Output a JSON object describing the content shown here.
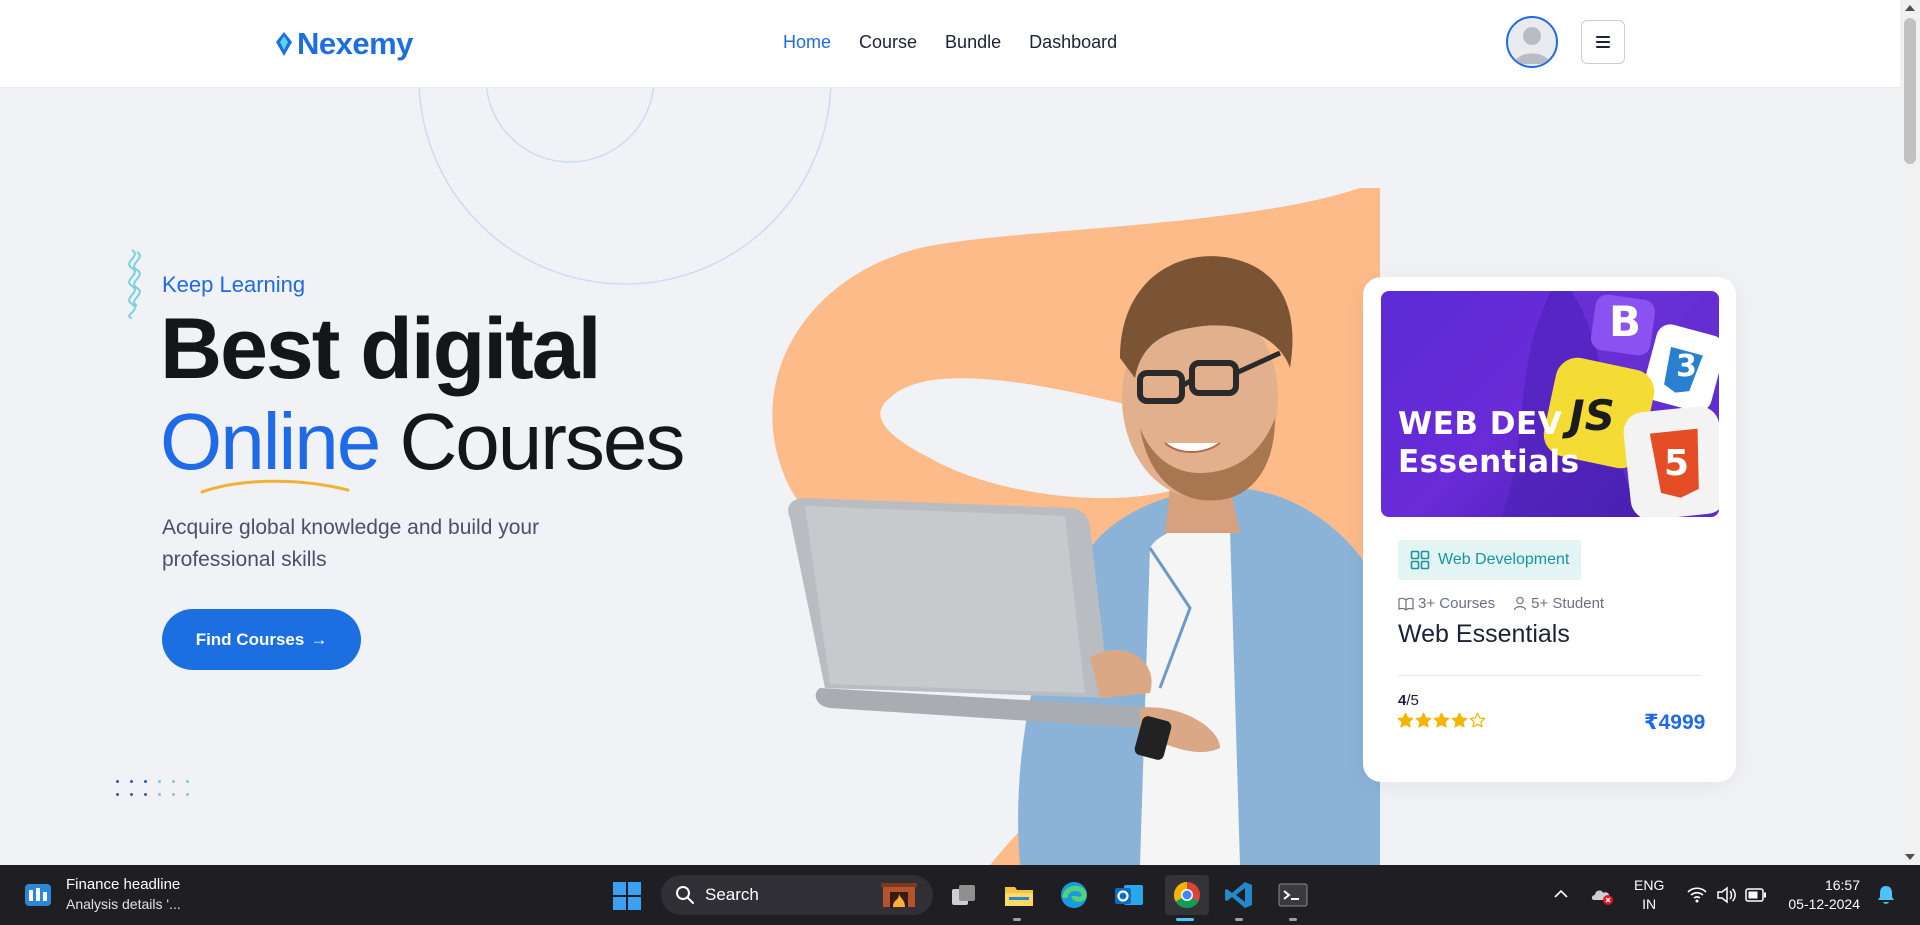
{
  "header": {
    "logo_text": "Nexemy",
    "nav": [
      {
        "label": "Home",
        "active": true
      },
      {
        "label": "Course",
        "active": false
      },
      {
        "label": "Bundle",
        "active": false
      },
      {
        "label": "Dashboard",
        "active": false
      }
    ]
  },
  "hero": {
    "eyebrow": "Keep Learning",
    "title_line1": "Best digital",
    "title_highlight": "Online",
    "title_rest": " Courses",
    "subtitle": "Acquire global knowledge and build your professional skills",
    "cta_label": "Find Courses",
    "cta_arrow": "→"
  },
  "course_card": {
    "image_title_line1": "WEB DEV",
    "image_title_line2": "Essentials",
    "image_badges": [
      "B",
      "JS",
      "3",
      "5"
    ],
    "category": "Web Development",
    "courses_count": "3+ Courses",
    "students_count": "5+ Student",
    "title": "Web Essentials",
    "rating_value": "4",
    "rating_max": "/5",
    "stars_filled": 4,
    "stars_total": 5,
    "price": "₹4999"
  },
  "taskbar": {
    "news_title": "Finance headline",
    "news_subtitle": "Analysis details '...",
    "search_placeholder": "Search",
    "lang_line1": "ENG",
    "lang_line2": "IN",
    "time": "16:57",
    "date": "05-12-2024"
  },
  "colors": {
    "brand_blue": "#1b6fe0",
    "peach": "#fdbb8a",
    "star": "#f4b400",
    "teal": "#17959a"
  }
}
